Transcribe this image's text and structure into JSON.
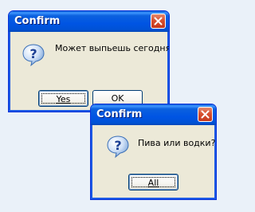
{
  "dialogs": [
    {
      "title": "Confirm",
      "message": "Может выпьешь сегодня?",
      "icon": "question-icon",
      "buttons": [
        {
          "label": "Yes",
          "focused": true
        },
        {
          "label": "OK",
          "focused": false
        }
      ]
    },
    {
      "title": "Confirm",
      "message": "Пива или водки?",
      "icon": "question-icon",
      "buttons": [
        {
          "label": "All",
          "focused": true
        }
      ]
    }
  ],
  "colors": {
    "titlebar": "#0054e3",
    "window_face": "#ece9d8",
    "close_button": "#d8502f",
    "desktop": "#eaf1f9"
  }
}
